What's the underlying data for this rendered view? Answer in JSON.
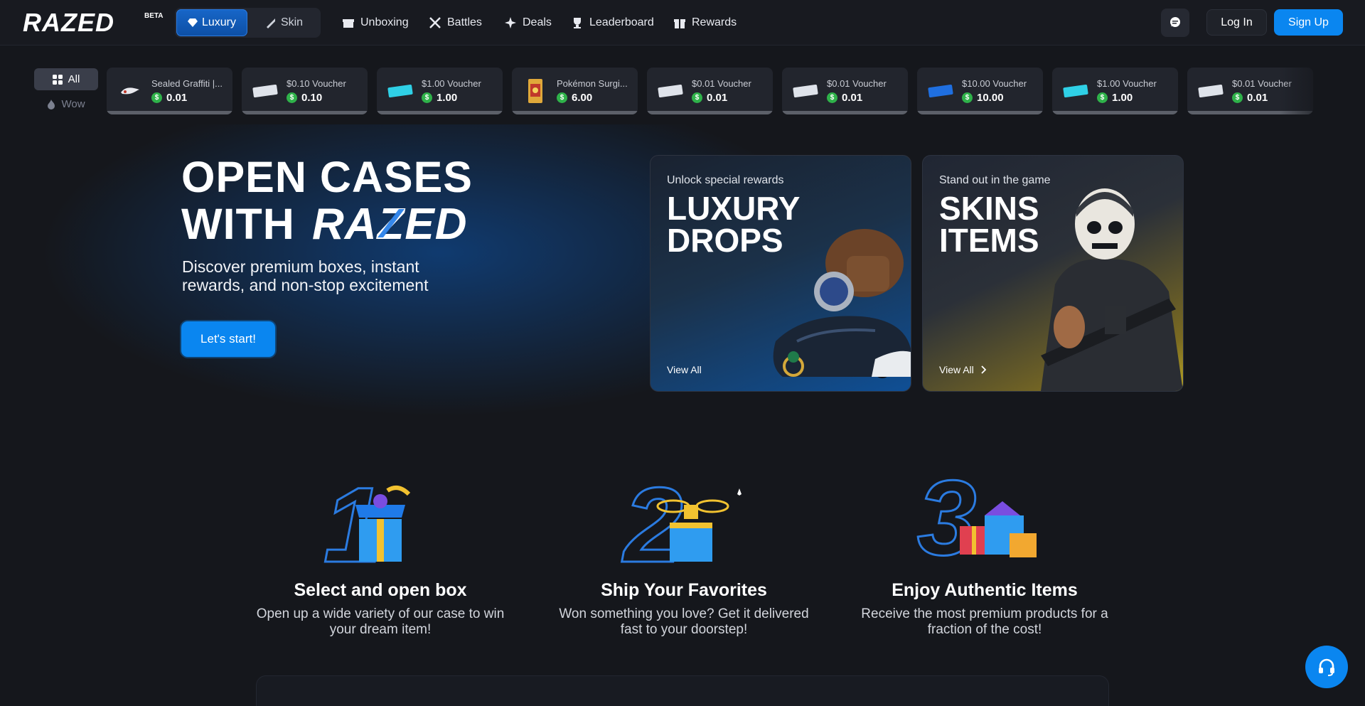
{
  "header": {
    "logo_text": "RAZED",
    "beta": "BETA",
    "segments": [
      {
        "label": "Luxury",
        "icon": "diamond-icon",
        "active": true
      },
      {
        "label": "Skin",
        "icon": "knife-icon",
        "active": false
      }
    ],
    "nav": [
      {
        "label": "Unboxing",
        "icon": "box-icon"
      },
      {
        "label": "Battles",
        "icon": "swords-icon"
      },
      {
        "label": "Deals",
        "icon": "sparkle-icon"
      },
      {
        "label": "Leaderboard",
        "icon": "trophy-icon"
      },
      {
        "label": "Rewards",
        "icon": "gift-icon"
      }
    ],
    "chat_icon": "chat-icon",
    "login": "Log In",
    "signup": "Sign Up"
  },
  "filters": {
    "all": "All",
    "wow": "Wow"
  },
  "drops": [
    {
      "name": "Sealed Graffiti |...",
      "price": "0.01",
      "thumb": "graffiti"
    },
    {
      "name": "$0.10 Voucher",
      "price": "0.10",
      "thumb": "voucher-white"
    },
    {
      "name": "$1.00 Voucher",
      "price": "1.00",
      "thumb": "voucher-cyan"
    },
    {
      "name": "Pokémon Surgi...",
      "price": "6.00",
      "thumb": "pokemon-pack"
    },
    {
      "name": "$0.01 Voucher",
      "price": "0.01",
      "thumb": "voucher-white"
    },
    {
      "name": "$0.01 Voucher",
      "price": "0.01",
      "thumb": "voucher-white"
    },
    {
      "name": "$10.00 Voucher",
      "price": "10.00",
      "thumb": "voucher-blue"
    },
    {
      "name": "$1.00 Voucher",
      "price": "1.00",
      "thumb": "voucher-cyan"
    },
    {
      "name": "$0.01 Voucher",
      "price": "0.01",
      "thumb": "voucher-white"
    }
  ],
  "coin_symbol": "$",
  "hero": {
    "line1": "OPEN CASES",
    "line2": "WITH",
    "sub": "Discover premium boxes, instant rewards, and non-stop excitement",
    "cta": "Let's start!"
  },
  "promos": {
    "luxury": {
      "kicker": "Unlock special rewards",
      "title": "LUXURY DROPS",
      "view": "View All"
    },
    "skins": {
      "kicker": "Stand out in the game",
      "title": "SKINS ITEMS",
      "view": "View All"
    }
  },
  "steps": [
    {
      "num": "1",
      "title": "Select and open box",
      "text": "Open up a wide variety of our case to win your dream item!"
    },
    {
      "num": "2",
      "title": "Ship Your Favorites",
      "text": "Won something you love? Get it delivered fast to your doorstep!"
    },
    {
      "num": "3",
      "title": "Enjoy Authentic Items",
      "text": "Receive the most premium products for a fraction of the cost!"
    }
  ],
  "colors": {
    "accent": "#0a86f0",
    "background": "#15171c",
    "coin": "#2fb24a"
  }
}
